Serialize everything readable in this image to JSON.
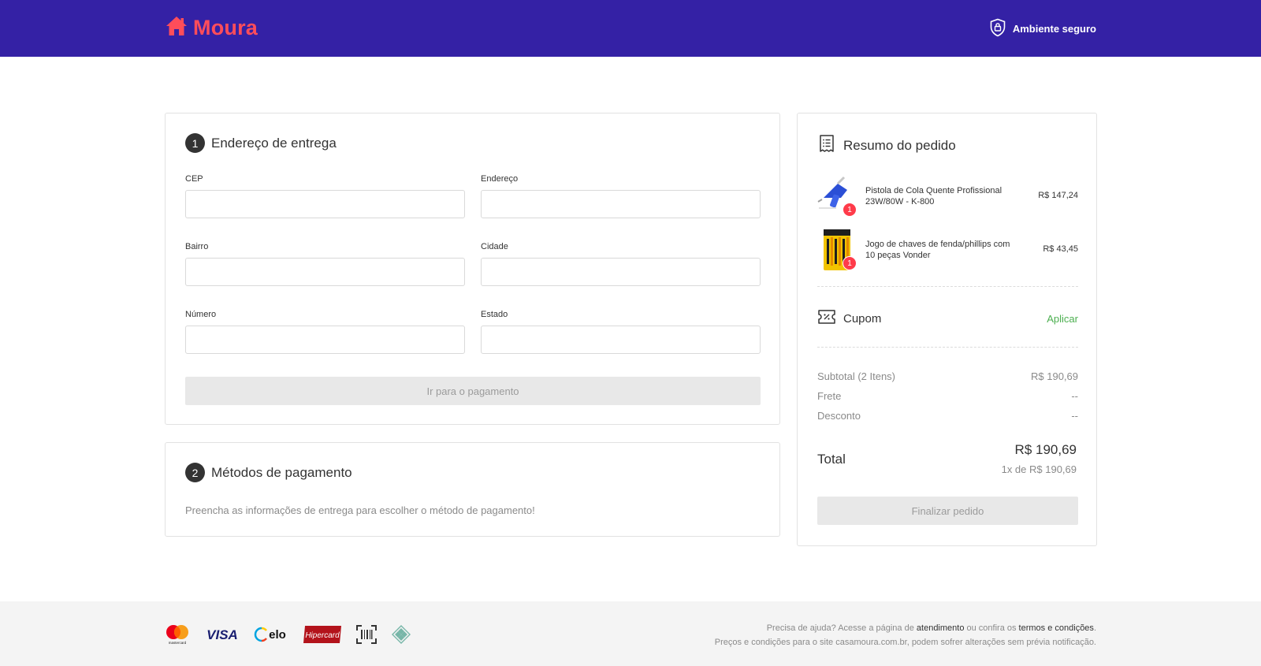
{
  "header": {
    "brand": "Moura",
    "secure_label": "Ambiente seguro"
  },
  "address": {
    "step": "1",
    "title": "Endereço de entrega",
    "fields": {
      "cep": {
        "label": "CEP",
        "value": ""
      },
      "endereco": {
        "label": "Endereço",
        "value": ""
      },
      "bairro": {
        "label": "Bairro",
        "value": ""
      },
      "cidade": {
        "label": "Cidade",
        "value": ""
      },
      "numero": {
        "label": "Número",
        "value": ""
      },
      "estado": {
        "label": "Estado",
        "value": ""
      }
    },
    "submit_label": "Ir para o pagamento"
  },
  "payment": {
    "step": "2",
    "title": "Métodos de pagamento",
    "hint": "Preencha as informações de entrega para escolher o método de pagamento!"
  },
  "summary": {
    "title": "Resumo do pedido",
    "items": [
      {
        "name": "Pistola de Cola Quente Profissional 23W/80W - K-800",
        "price": "R$ 147,24",
        "qty": "1"
      },
      {
        "name": "Jogo de chaves de fenda/phillips com 10 peças Vonder",
        "price": "R$ 43,45",
        "qty": "1"
      }
    ],
    "coupon_label": "Cupom",
    "coupon_action": "Aplicar",
    "subtotal_label": "Subtotal (2 Itens)",
    "subtotal_value": "R$ 190,69",
    "frete_label": "Frete",
    "frete_value": "--",
    "desconto_label": "Desconto",
    "desconto_value": "--",
    "total_label": "Total",
    "total_value": "R$ 190,69",
    "installments": "1x de R$ 190,69",
    "finalize_label": "Finalizar pedido"
  },
  "footer": {
    "payment_icons": [
      "mastercard-icon",
      "visa-icon",
      "elo-icon",
      "hipercard-icon",
      "boleto-icon",
      "pix-icon"
    ],
    "mastercard_text": "mastercard",
    "visa_text": "VISA",
    "elo_text": "elo",
    "hipercard_text": "Hipercard",
    "help_prefix": "Precisa de ajuda? Acesse a página de ",
    "help_link": "atendimento",
    "help_middle": " ou confira os ",
    "terms_link": "termos e condições",
    "help_suffix": ".",
    "disclaimer": "Preços e condições para o site casamoura.com.br, podem sofrer alterações sem prévia notificação."
  },
  "colors": {
    "header_bg": "#3421a5",
    "brand": "#ff4d5a",
    "apply": "#4caf50",
    "badge": "#ff3b4a"
  }
}
